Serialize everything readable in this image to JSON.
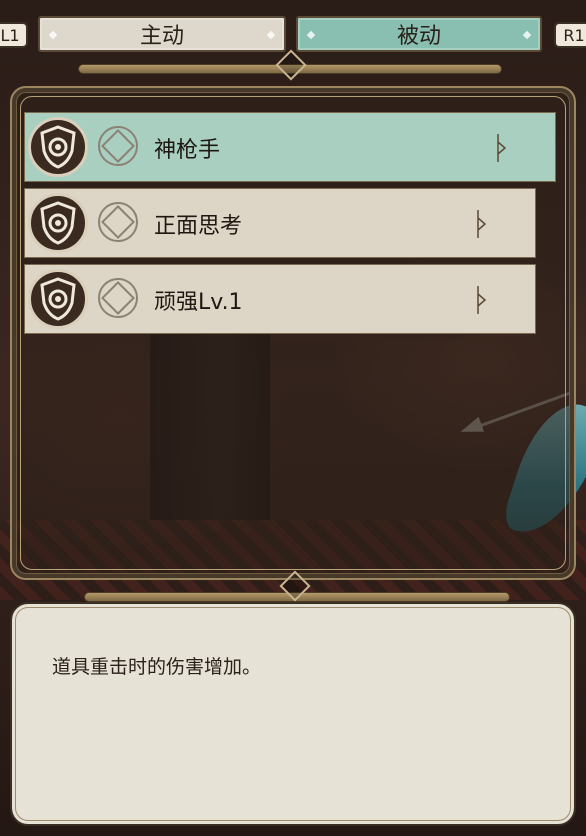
{
  "tabs": {
    "left_shoulder": "L1",
    "right_shoulder": "R1",
    "active": "主动",
    "passive": "被动",
    "selected": "passive"
  },
  "skills": [
    {
      "name": "神枪手",
      "selected": true,
      "icon": "shield-icon"
    },
    {
      "name": "正面思考",
      "selected": false,
      "icon": "shield-icon"
    },
    {
      "name": "顽强Lv.1",
      "selected": false,
      "icon": "shield-icon"
    }
  ],
  "description": {
    "text": "道具重击时的伤害增加。"
  },
  "colors": {
    "passive_tab": "#88bfb1",
    "selected_row": "#a9cfc1",
    "row": "#ddd5c5",
    "frame_gold": "#9c8660",
    "desc_bg": "#e7e2d6"
  }
}
